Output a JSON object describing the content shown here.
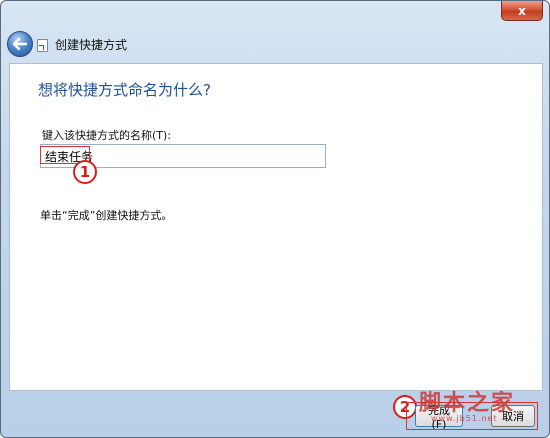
{
  "window": {
    "close_label": "x"
  },
  "nav": {
    "title": "创建快捷方式",
    "back_icon": "back-arrow-icon",
    "shortcut_icon": "shortcut-icon"
  },
  "main": {
    "heading": "想将快捷方式命名为什么?",
    "field_label": "键入该快捷方式的名称(T):",
    "name_value": "结束任务",
    "hint": "单击“完成”创建快捷方式。"
  },
  "annotations": {
    "marker_1": "1",
    "marker_2": "2"
  },
  "footer": {
    "finish_label": "完成(F)",
    "cancel_label": "取消"
  },
  "watermark": {
    "text": "脚本之家",
    "url": "www.jb51.net"
  },
  "colors": {
    "heading": "#1e4f95",
    "marker": "#d41f1f",
    "close_button": "#d2553a"
  }
}
